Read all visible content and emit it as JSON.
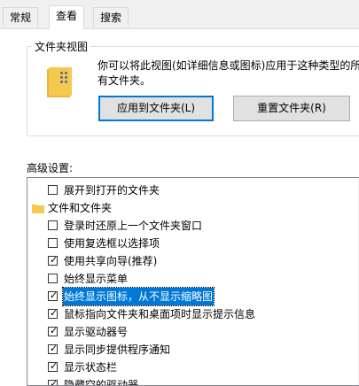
{
  "tabs": [
    {
      "label": "常规",
      "active": false
    },
    {
      "label": "查看",
      "active": true
    },
    {
      "label": "搜索",
      "active": false
    }
  ],
  "folder_views": {
    "title": "文件夹视图",
    "description_line1": "你可以将此视图(如详细信息或图标)应用于这种类型的所",
    "description_line2": "有文件夹。",
    "apply_button": "应用到文件夹(L)",
    "reset_button": "重置文件夹(R)"
  },
  "advanced": {
    "label": "高级设置:",
    "items": [
      {
        "type": "checkbox",
        "label": "展开到打开的文件夹",
        "checked": false
      },
      {
        "type": "folder",
        "label": "文件和文件夹"
      },
      {
        "type": "checkbox",
        "label": "登录时还原上一个文件夹窗口",
        "checked": false
      },
      {
        "type": "checkbox",
        "label": "使用复选框以选择项",
        "checked": false
      },
      {
        "type": "checkbox",
        "label": "使用共享向导(推荐)",
        "checked": true
      },
      {
        "type": "checkbox",
        "label": "始终显示菜单",
        "checked": false
      },
      {
        "type": "checkbox",
        "label": "始终显示图标，从不显示缩略图",
        "checked": true,
        "selected": true
      },
      {
        "type": "checkbox",
        "label": "鼠标指向文件夹和桌面项时显示提示信息",
        "checked": true
      },
      {
        "type": "checkbox",
        "label": "显示驱动器号",
        "checked": true
      },
      {
        "type": "checkbox",
        "label": "显示同步提供程序通知",
        "checked": true
      },
      {
        "type": "checkbox",
        "label": "显示状态栏",
        "checked": true
      },
      {
        "type": "checkbox",
        "label": "隐藏空的驱动器",
        "checked": true
      }
    ]
  },
  "colors": {
    "accent": "#0078d7",
    "folder": "#f5c94d"
  }
}
